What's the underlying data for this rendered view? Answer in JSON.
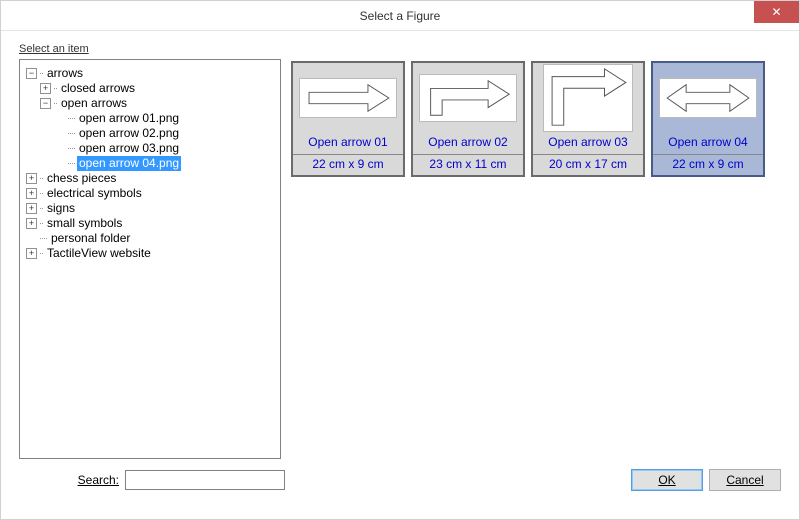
{
  "window": {
    "title": "Select a Figure",
    "close_glyph": "✕"
  },
  "group_label": "Select an item",
  "tree": {
    "root": {
      "label": "arrows",
      "expander": "−",
      "children": {
        "closed": {
          "label": "closed arrows",
          "expander": "+"
        },
        "open": {
          "label": "open arrows",
          "expander": "−",
          "items": [
            "open arrow 01.png",
            "open arrow 02.png",
            "open arrow 03.png",
            "open arrow 04.png"
          ],
          "selected_index": 3
        }
      }
    },
    "siblings": [
      {
        "label": "chess pieces",
        "expander": "+"
      },
      {
        "label": "electrical symbols",
        "expander": "+"
      },
      {
        "label": "signs",
        "expander": "+"
      },
      {
        "label": "small symbols",
        "expander": "+"
      },
      {
        "label": "personal folder",
        "expander": ""
      },
      {
        "label": "TactileView website",
        "expander": "+"
      }
    ]
  },
  "thumbs": [
    {
      "caption": "Open arrow 01",
      "dims": "22 cm x 9 cm",
      "selected": false
    },
    {
      "caption": "Open arrow 02",
      "dims": "23 cm x 11 cm",
      "selected": false
    },
    {
      "caption": "Open arrow 03",
      "dims": "20 cm x 17 cm",
      "selected": false
    },
    {
      "caption": "Open arrow 04",
      "dims": "22 cm x 9 cm",
      "selected": true
    }
  ],
  "search": {
    "label": "Search:",
    "value": ""
  },
  "buttons": {
    "ok": "OK",
    "cancel": "Cancel"
  }
}
